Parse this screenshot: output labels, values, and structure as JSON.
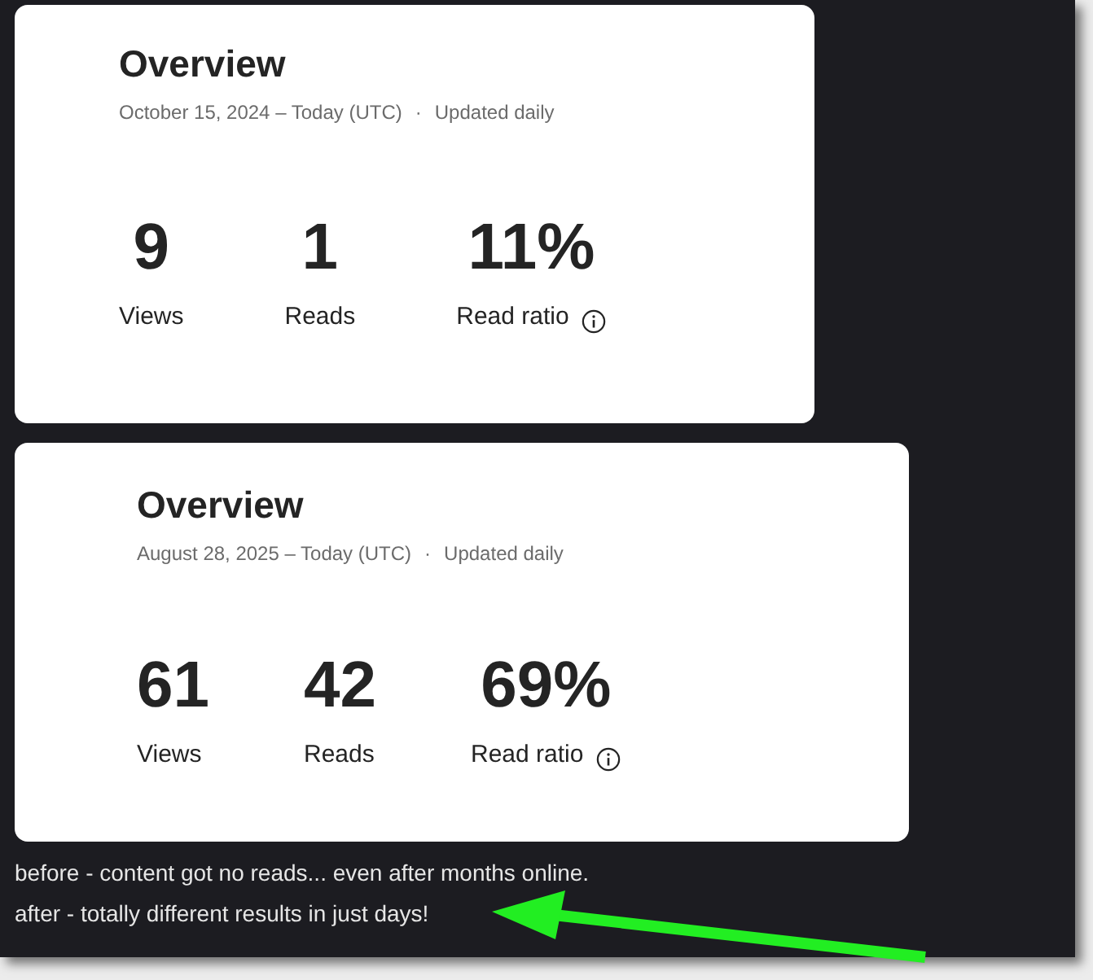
{
  "cards": [
    {
      "title": "Overview",
      "date_range": "October 15, 2024 – Today (UTC)",
      "separator": "·",
      "update_note": "Updated daily",
      "stats": [
        {
          "value": "9",
          "label": "Views",
          "info": false
        },
        {
          "value": "1",
          "label": "Reads",
          "info": false
        },
        {
          "value": "11%",
          "label": "Read ratio",
          "info": true
        }
      ]
    },
    {
      "title": "Overview",
      "date_range": "August 28, 2025 – Today (UTC)",
      "separator": "·",
      "update_note": "Updated daily",
      "stats": [
        {
          "value": "61",
          "label": "Views",
          "info": false
        },
        {
          "value": "42",
          "label": "Reads",
          "info": false
        },
        {
          "value": "69%",
          "label": "Read ratio",
          "info": true
        }
      ]
    }
  ],
  "captions": [
    "before - content got no reads... even after months online.",
    "after - totally different results in just days!"
  ]
}
